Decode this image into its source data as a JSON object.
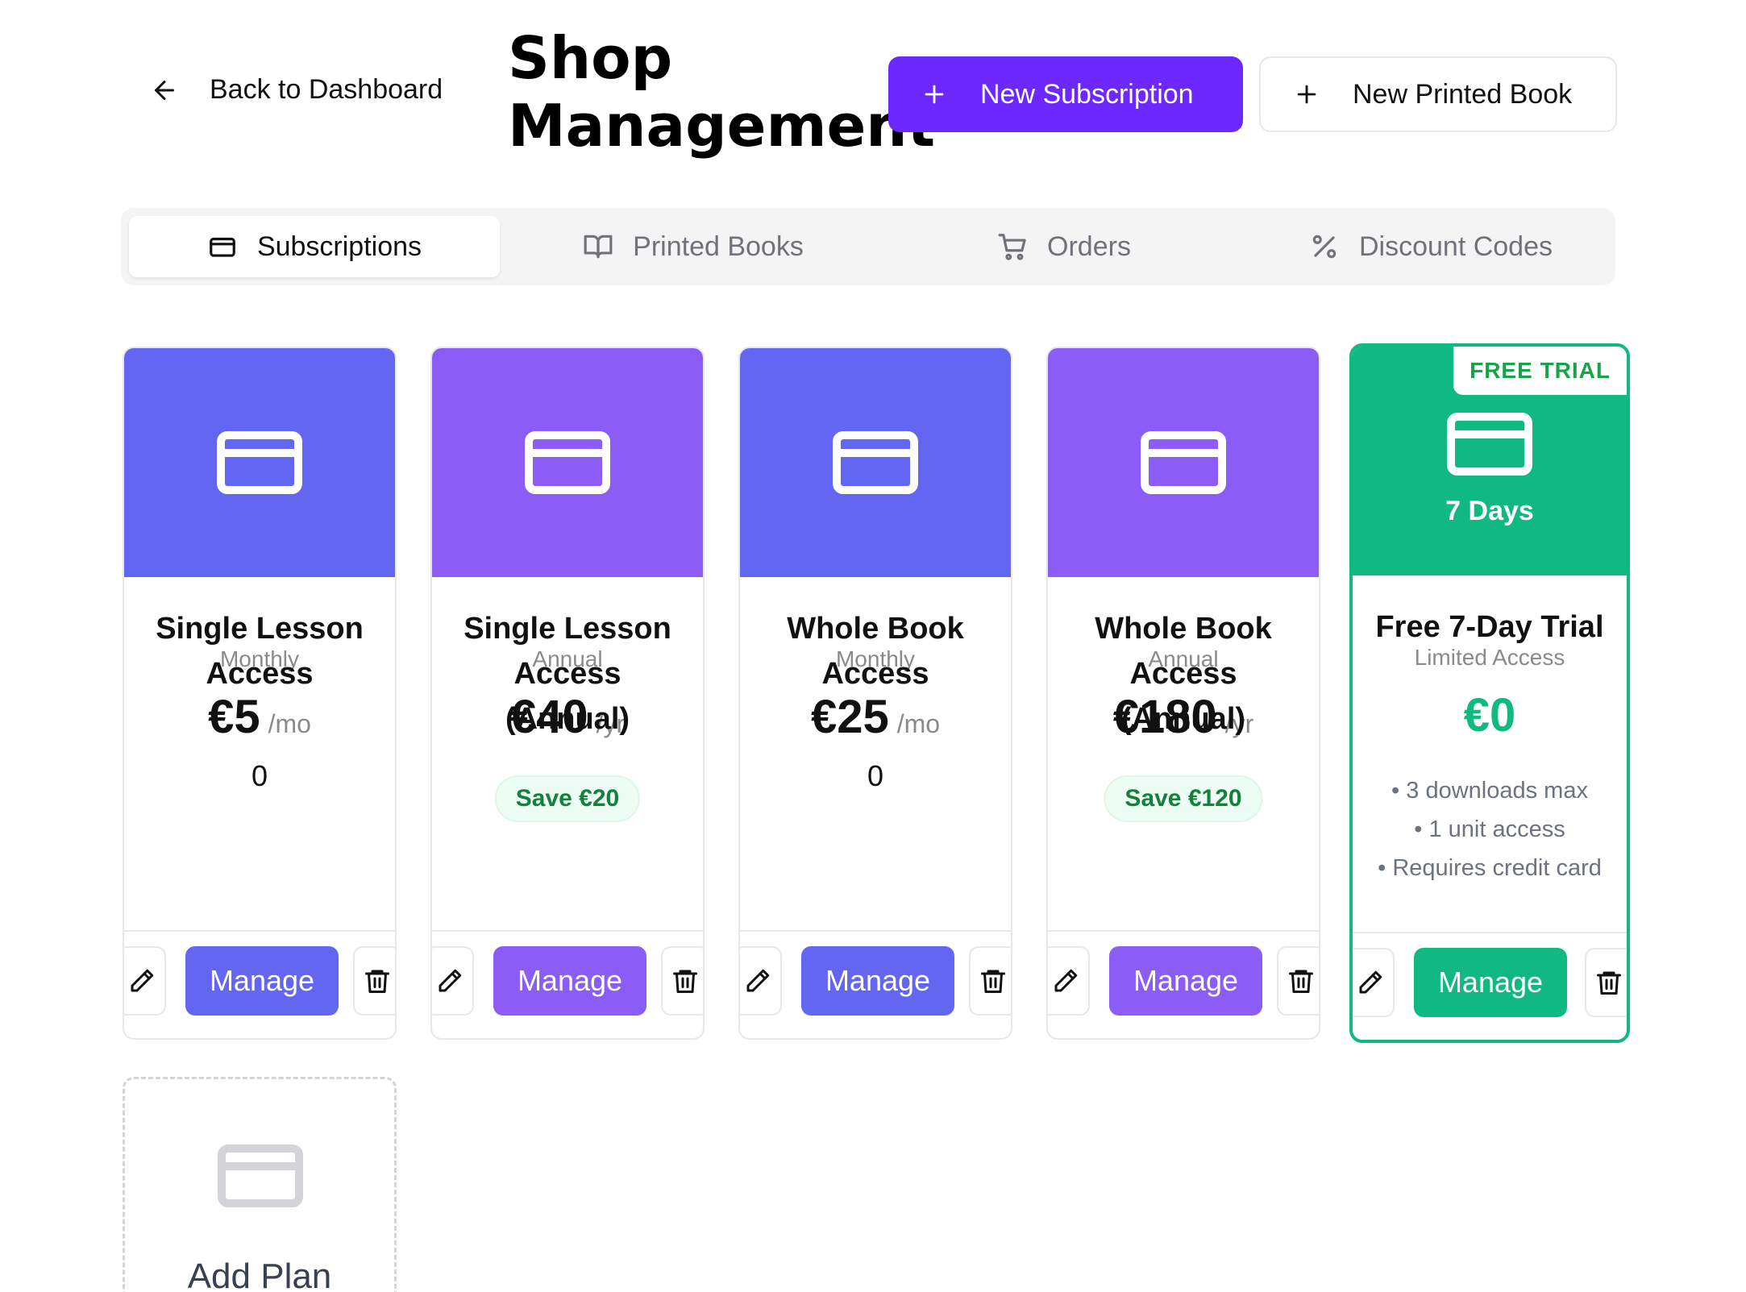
{
  "header": {
    "back_label": "Back to Dashboard",
    "title_line1": "Shop",
    "title_line2": "Management",
    "new_subscription_label": "New Subscription",
    "new_printed_book_label": "New Printed Book"
  },
  "tabs": [
    {
      "label": "Subscriptions",
      "icon": "card-icon",
      "active": true
    },
    {
      "label": "Printed Books",
      "icon": "book-icon",
      "active": false
    },
    {
      "label": "Orders",
      "icon": "cart-icon",
      "active": false
    },
    {
      "label": "Discount Codes",
      "icon": "percent-icon",
      "active": false
    }
  ],
  "colors": {
    "indigo": "#6366f1",
    "violet": "#8b5cf6",
    "green": "#10b981",
    "primary_button": "#6d28ff"
  },
  "plans": [
    {
      "name": "Single Lesson Access",
      "subtitle": "Monthly",
      "price": "€5",
      "period": "/mo",
      "count": "0",
      "manage_label": "Manage"
    },
    {
      "name": "Single Lesson Access (Annual)",
      "subtitle": "Annual",
      "price": "€40",
      "period": "/yr",
      "save": "Save €20",
      "manage_label": "Manage"
    },
    {
      "name": "Whole Book Access",
      "subtitle": "Monthly",
      "price": "€25",
      "period": "/mo",
      "count": "0",
      "manage_label": "Manage"
    },
    {
      "name": "Whole Book Access (Annual)",
      "subtitle": "Annual",
      "price": "€180",
      "period": "/yr",
      "save": "Save €120",
      "manage_label": "Manage"
    },
    {
      "name": "Free 7-Day Trial",
      "subtitle": "Limited Access",
      "price": "€0",
      "badge": "FREE TRIAL",
      "hero_text": "7 Days",
      "features": [
        "3 downloads max",
        "1 unit access",
        "Requires credit card"
      ],
      "manage_label": "Manage"
    }
  ],
  "add_plan_label": "Add Plan"
}
